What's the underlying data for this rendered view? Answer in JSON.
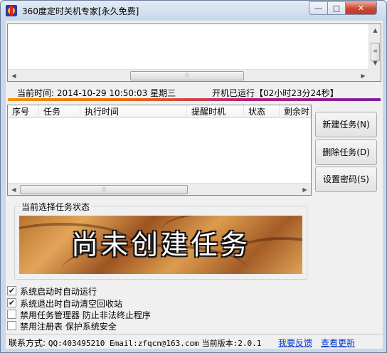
{
  "window": {
    "title": "360度定时关机专家[永久免费]",
    "controls": {
      "minimize": "—",
      "maximize": "□",
      "close": "✕"
    }
  },
  "log": {
    "text": "",
    "scroll_grip": "⦙⦙⦙"
  },
  "status": {
    "current_time": "当前时间: 2014-10-29 10:50:03 星期三",
    "uptime": "开机已运行【02小时23分24秒】"
  },
  "task_list": {
    "columns": [
      "序号",
      "任务",
      "执行时间",
      "提醒时机",
      "状态",
      "剩余时间"
    ],
    "rows": [],
    "scroll_grip": "⦙⦙⦙"
  },
  "buttons": {
    "new_task": "新建任务(N)",
    "delete_task": "删除任务(D)",
    "set_password": "设置密码(S)"
  },
  "current_task": {
    "group_label": "当前选择任务状态",
    "banner_text": "尚未创建任务"
  },
  "options": [
    {
      "label": "系统启动时自动运行",
      "checked": true
    },
    {
      "label": "系统退出时自动清空回收站",
      "checked": true
    },
    {
      "label": "禁用任务管理器 防止非法终止程序",
      "checked": false
    },
    {
      "label": "禁用注册表 保护系统安全",
      "checked": false
    }
  ],
  "footer": {
    "contact_label": "联系方式:",
    "contact_value": "QQ:403495210 Email:zfqcn@163.com",
    "version": "当前版本:2.0.1",
    "feedback_link": "我要反馈",
    "update_link": "查看更新"
  }
}
